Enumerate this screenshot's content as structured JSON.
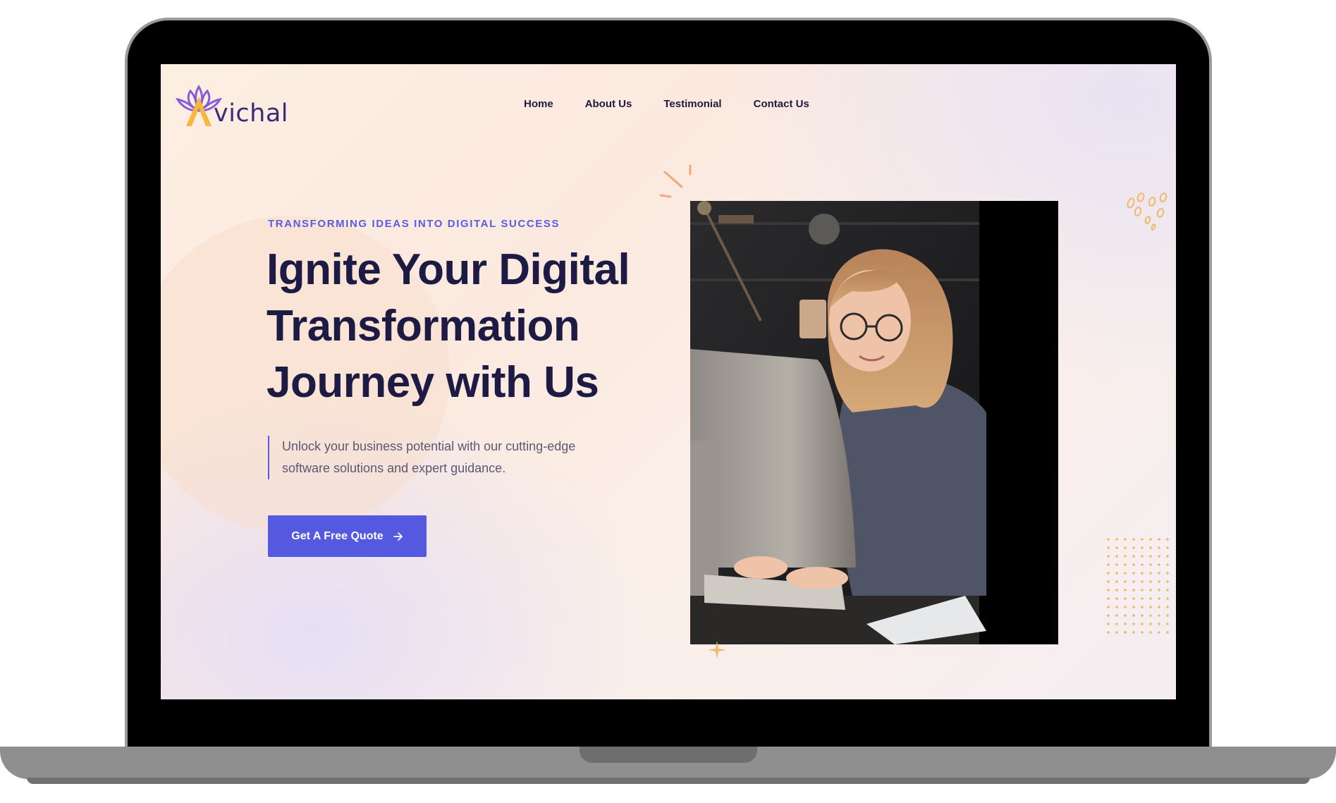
{
  "brand": {
    "name": "vichal",
    "logo_icon": "lotus-icon",
    "colors": {
      "purple": "#7b4fc9",
      "gold": "#f5b83a",
      "text": "#3b2a7a"
    }
  },
  "nav": {
    "items": [
      {
        "label": "Home"
      },
      {
        "label": "About Us"
      },
      {
        "label": "Testimonial"
      },
      {
        "label": "Contact Us"
      }
    ]
  },
  "hero": {
    "eyebrow": "TRANSFORMING IDEAS INTO DIGITAL SUCCESS",
    "headline_line1": "Ignite Your Digital",
    "headline_line2": "Transformation",
    "headline_line3": "Journey with Us",
    "subtext": "Unlock your business potential with our cutting-edge software solutions and expert guidance.",
    "cta_label": "Get A Free Quote",
    "cta_icon": "arrow-right-icon",
    "accent_color": "#5559e0"
  }
}
